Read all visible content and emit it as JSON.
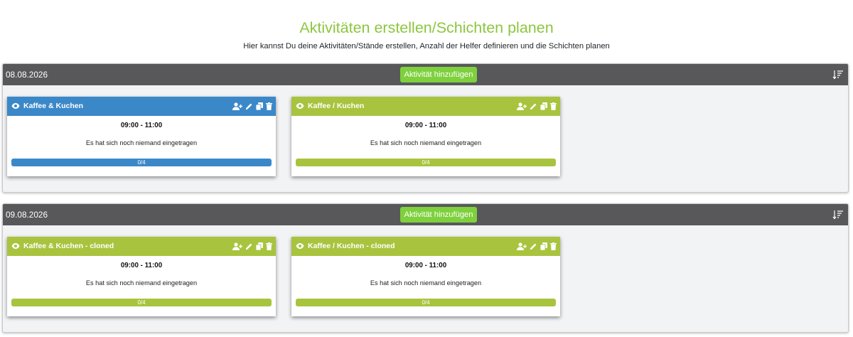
{
  "page": {
    "title": "Aktivitäten erstellen/Schichten planen",
    "subtitle": "Hier kannst Du deine Aktivitäten/Stände erstellen, Anzahl der Helfer definieren und die Schichten planen"
  },
  "colors": {
    "title": "#8cc63f",
    "header": "#58585a",
    "add_button": "#7ed03d",
    "card_blue": "#3b88c9",
    "card_green": "#a8c43e"
  },
  "icons": {
    "sort": "sort-descending-icon",
    "visibility": "eye-icon",
    "add_helper": "user-plus-icon",
    "edit": "pencil-icon",
    "copy": "copy-icon",
    "delete": "trash-icon"
  },
  "days": [
    {
      "date": "08.08.2026",
      "add_label": "Aktivität hinzufügen",
      "cards": [
        {
          "title": "Kaffee & Kuchen",
          "time": "09:00 - 11:00",
          "status": "Es hat sich noch niemand eingetragen",
          "progress": "0/4",
          "color": "blue"
        },
        {
          "title": "Kaffee / Kuchen",
          "time": "09:00 - 11:00",
          "status": "Es hat sich noch niemand eingetragen",
          "progress": "0/4",
          "color": "green"
        }
      ]
    },
    {
      "date": "09.08.2026",
      "add_label": "Aktivität hinzufügen",
      "cards": [
        {
          "title": "Kaffee & Kuchen - cloned",
          "time": "09:00 - 11:00",
          "status": "Es hat sich noch niemand eingetragen",
          "progress": "0/4",
          "color": "green"
        },
        {
          "title": "Kaffee / Kuchen - cloned",
          "time": "09:00 - 11:00",
          "status": "Es hat sich noch niemand eingetragen",
          "progress": "0/4",
          "color": "green"
        }
      ]
    }
  ]
}
